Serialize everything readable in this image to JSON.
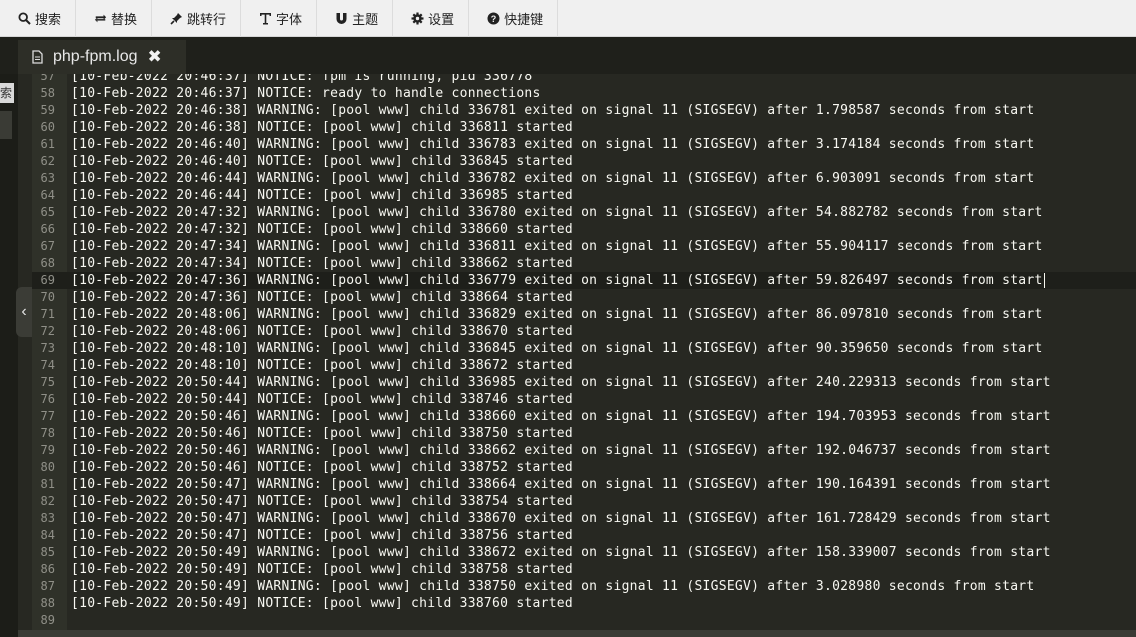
{
  "toolbar": {
    "search": "搜索",
    "replace": "替换",
    "goto_line": "跳转行",
    "font": "字体",
    "theme": "主题",
    "settings": "设置",
    "shortcuts": "快捷键"
  },
  "tab": {
    "filename": "php-fpm.log",
    "close": "✖"
  },
  "side": {
    "label": "索",
    "collapse": "‹"
  },
  "editor": {
    "active_line": 69,
    "lines": [
      {
        "n": "57",
        "t": "[10-Feb-2022 20:46:37] NOTICE: fpm is running, pid 336778"
      },
      {
        "n": "58",
        "t": "[10-Feb-2022 20:46:37] NOTICE: ready to handle connections"
      },
      {
        "n": "59",
        "t": "[10-Feb-2022 20:46:38] WARNING: [pool www] child 336781 exited on signal 11 (SIGSEGV) after 1.798587 seconds from start"
      },
      {
        "n": "60",
        "t": "[10-Feb-2022 20:46:38] NOTICE: [pool www] child 336811 started"
      },
      {
        "n": "61",
        "t": "[10-Feb-2022 20:46:40] WARNING: [pool www] child 336783 exited on signal 11 (SIGSEGV) after 3.174184 seconds from start"
      },
      {
        "n": "62",
        "t": "[10-Feb-2022 20:46:40] NOTICE: [pool www] child 336845 started"
      },
      {
        "n": "63",
        "t": "[10-Feb-2022 20:46:44] WARNING: [pool www] child 336782 exited on signal 11 (SIGSEGV) after 6.903091 seconds from start"
      },
      {
        "n": "64",
        "t": "[10-Feb-2022 20:46:44] NOTICE: [pool www] child 336985 started"
      },
      {
        "n": "65",
        "t": "[10-Feb-2022 20:47:32] WARNING: [pool www] child 336780 exited on signal 11 (SIGSEGV) after 54.882782 seconds from start"
      },
      {
        "n": "66",
        "t": "[10-Feb-2022 20:47:32] NOTICE: [pool www] child 338660 started"
      },
      {
        "n": "67",
        "t": "[10-Feb-2022 20:47:34] WARNING: [pool www] child 336811 exited on signal 11 (SIGSEGV) after 55.904117 seconds from start"
      },
      {
        "n": "68",
        "t": "[10-Feb-2022 20:47:34] NOTICE: [pool www] child 338662 started"
      },
      {
        "n": "69",
        "t": "[10-Feb-2022 20:47:36] WARNING: [pool www] child 336779 exited on signal 11 (SIGSEGV) after 59.826497 seconds from start"
      },
      {
        "n": "70",
        "t": "[10-Feb-2022 20:47:36] NOTICE: [pool www] child 338664 started"
      },
      {
        "n": "71",
        "t": "[10-Feb-2022 20:48:06] WARNING: [pool www] child 336829 exited on signal 11 (SIGSEGV) after 86.097810 seconds from start"
      },
      {
        "n": "72",
        "t": "[10-Feb-2022 20:48:06] NOTICE: [pool www] child 338670 started"
      },
      {
        "n": "73",
        "t": "[10-Feb-2022 20:48:10] WARNING: [pool www] child 336845 exited on signal 11 (SIGSEGV) after 90.359650 seconds from start"
      },
      {
        "n": "74",
        "t": "[10-Feb-2022 20:48:10] NOTICE: [pool www] child 338672 started"
      },
      {
        "n": "75",
        "t": "[10-Feb-2022 20:50:44] WARNING: [pool www] child 336985 exited on signal 11 (SIGSEGV) after 240.229313 seconds from start"
      },
      {
        "n": "76",
        "t": "[10-Feb-2022 20:50:44] NOTICE: [pool www] child 338746 started"
      },
      {
        "n": "77",
        "t": "[10-Feb-2022 20:50:46] WARNING: [pool www] child 338660 exited on signal 11 (SIGSEGV) after 194.703953 seconds from start"
      },
      {
        "n": "78",
        "t": "[10-Feb-2022 20:50:46] NOTICE: [pool www] child 338750 started"
      },
      {
        "n": "79",
        "t": "[10-Feb-2022 20:50:46] WARNING: [pool www] child 338662 exited on signal 11 (SIGSEGV) after 192.046737 seconds from start"
      },
      {
        "n": "80",
        "t": "[10-Feb-2022 20:50:46] NOTICE: [pool www] child 338752 started"
      },
      {
        "n": "81",
        "t": "[10-Feb-2022 20:50:47] WARNING: [pool www] child 338664 exited on signal 11 (SIGSEGV) after 190.164391 seconds from start"
      },
      {
        "n": "82",
        "t": "[10-Feb-2022 20:50:47] NOTICE: [pool www] child 338754 started"
      },
      {
        "n": "83",
        "t": "[10-Feb-2022 20:50:47] WARNING: [pool www] child 338670 exited on signal 11 (SIGSEGV) after 161.728429 seconds from start"
      },
      {
        "n": "84",
        "t": "[10-Feb-2022 20:50:47] NOTICE: [pool www] child 338756 started"
      },
      {
        "n": "85",
        "t": "[10-Feb-2022 20:50:49] WARNING: [pool www] child 338672 exited on signal 11 (SIGSEGV) after 158.339007 seconds from start"
      },
      {
        "n": "86",
        "t": "[10-Feb-2022 20:50:49] NOTICE: [pool www] child 338758 started"
      },
      {
        "n": "87",
        "t": "[10-Feb-2022 20:50:49] WARNING: [pool www] child 338750 exited on signal 11 (SIGSEGV) after 3.028980 seconds from start"
      },
      {
        "n": "88",
        "t": "[10-Feb-2022 20:50:49] NOTICE: [pool www] child 338760 started"
      },
      {
        "n": "89",
        "t": ""
      }
    ]
  },
  "icons": {
    "search": "search-icon",
    "replace": "swap-icon",
    "goto": "pin-icon",
    "font": "text-icon",
    "theme": "magnet-icon",
    "settings": "gear-icon",
    "shortcuts": "question-icon",
    "file": "document-icon"
  }
}
